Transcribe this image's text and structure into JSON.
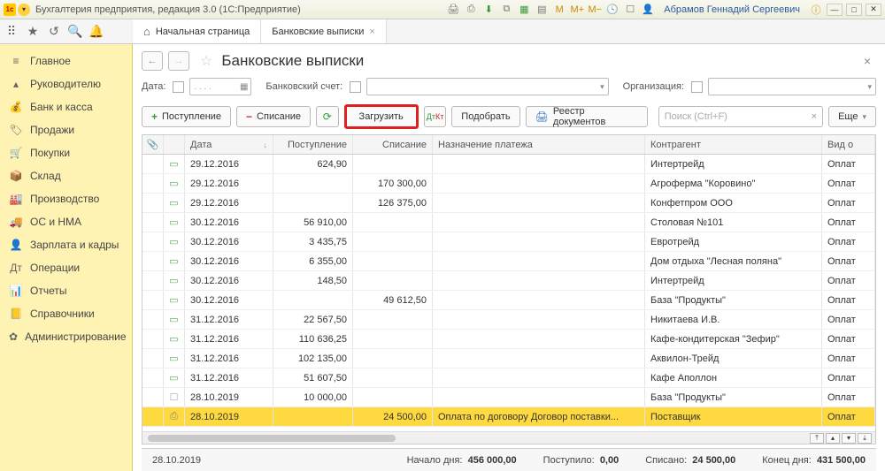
{
  "window": {
    "title": "Бухгалтерия предприятия, редакция 3.0  (1С:Предприятие)",
    "user": "Абрамов Геннадий Сергеевич",
    "m": "M",
    "mplus": "M+",
    "mminus": "M−"
  },
  "tabs": {
    "home": "Начальная страница",
    "current": "Банковские выписки"
  },
  "sidebar": {
    "items": [
      {
        "label": "Главное",
        "icon": "≡"
      },
      {
        "label": "Руководителю",
        "icon": "▴"
      },
      {
        "label": "Банк и касса",
        "icon": "💰"
      },
      {
        "label": "Продажи",
        "icon": "🏷"
      },
      {
        "label": "Покупки",
        "icon": "🛒"
      },
      {
        "label": "Склад",
        "icon": "📦"
      },
      {
        "label": "Производство",
        "icon": "🏭"
      },
      {
        "label": "ОС и НМА",
        "icon": "🚚"
      },
      {
        "label": "Зарплата и кадры",
        "icon": "👤"
      },
      {
        "label": "Операции",
        "icon": "Дт"
      },
      {
        "label": "Отчеты",
        "icon": "📊"
      },
      {
        "label": "Справочники",
        "icon": "📒"
      },
      {
        "label": "Администрирование",
        "icon": "✿"
      }
    ]
  },
  "page": {
    "title": "Банковские выписки"
  },
  "filters": {
    "date_label": "Дата:",
    "date_placeholder": ". .  . .",
    "account_label": "Банковский счет:",
    "org_label": "Организация:"
  },
  "toolbar": {
    "receipt": "Поступление",
    "writeoff": "Списание",
    "load": "Загрузить",
    "pick": "Подобрать",
    "registry": "Реестр документов",
    "search_placeholder": "Поиск (Ctrl+F)",
    "more": "Еще"
  },
  "grid": {
    "headers": {
      "date": "Дата",
      "in": "Поступление",
      "out": "Списание",
      "purpose": "Назначение платежа",
      "contr": "Контрагент",
      "type": "Вид о"
    },
    "rows": [
      {
        "date": "29.12.2016",
        "in": "624,90",
        "out": "",
        "purpose": "",
        "contr": "Интертрейд",
        "type": "Оплат"
      },
      {
        "date": "29.12.2016",
        "in": "",
        "out": "170 300,00",
        "purpose": "",
        "contr": "Агроферма \"Коровино\"",
        "type": "Оплат"
      },
      {
        "date": "29.12.2016",
        "in": "",
        "out": "126 375,00",
        "purpose": "",
        "contr": "Конфетпром ООО",
        "type": "Оплат"
      },
      {
        "date": "30.12.2016",
        "in": "56 910,00",
        "out": "",
        "purpose": "",
        "contr": "Столовая №101",
        "type": "Оплат"
      },
      {
        "date": "30.12.2016",
        "in": "3 435,75",
        "out": "",
        "purpose": "",
        "contr": "Евротрейд",
        "type": "Оплат"
      },
      {
        "date": "30.12.2016",
        "in": "6 355,00",
        "out": "",
        "purpose": "",
        "contr": "Дом отдыха \"Лесная поляна\"",
        "type": "Оплат"
      },
      {
        "date": "30.12.2016",
        "in": "148,50",
        "out": "",
        "purpose": "",
        "contr": "Интертрейд",
        "type": "Оплат"
      },
      {
        "date": "30.12.2016",
        "in": "",
        "out": "49 612,50",
        "purpose": "",
        "contr": "База \"Продукты\"",
        "type": "Оплат"
      },
      {
        "date": "31.12.2016",
        "in": "22 567,50",
        "out": "",
        "purpose": "",
        "contr": "Никитаева И.В.",
        "type": "Оплат"
      },
      {
        "date": "31.12.2016",
        "in": "110 636,25",
        "out": "",
        "purpose": "",
        "contr": "Кафе-кондитерская \"Зефир\"",
        "type": "Оплат"
      },
      {
        "date": "31.12.2016",
        "in": "102 135,00",
        "out": "",
        "purpose": "",
        "contr": "Аквилон-Трейд",
        "type": "Оплат"
      },
      {
        "date": "31.12.2016",
        "in": "51 607,50",
        "out": "",
        "purpose": "",
        "contr": "Кафе Аполлон",
        "type": "Оплат"
      },
      {
        "date": "28.10.2019",
        "in": "10 000,00",
        "out": "",
        "purpose": "",
        "contr": "База \"Продукты\"",
        "type": "Оплат",
        "draft": true
      },
      {
        "date": "28.10.2019",
        "in": "",
        "out": "24 500,00",
        "purpose": "Оплата по договору Договор поставки...",
        "contr": "Поставщик",
        "type": "Оплат",
        "selected": true
      }
    ]
  },
  "status": {
    "date": "28.10.2019",
    "start_label": "Начало дня:",
    "start": "456 000,00",
    "in_label": "Поступило:",
    "in": "0,00",
    "out_label": "Списано:",
    "out": "24 500,00",
    "end_label": "Конец дня:",
    "end": "431 500,00"
  }
}
